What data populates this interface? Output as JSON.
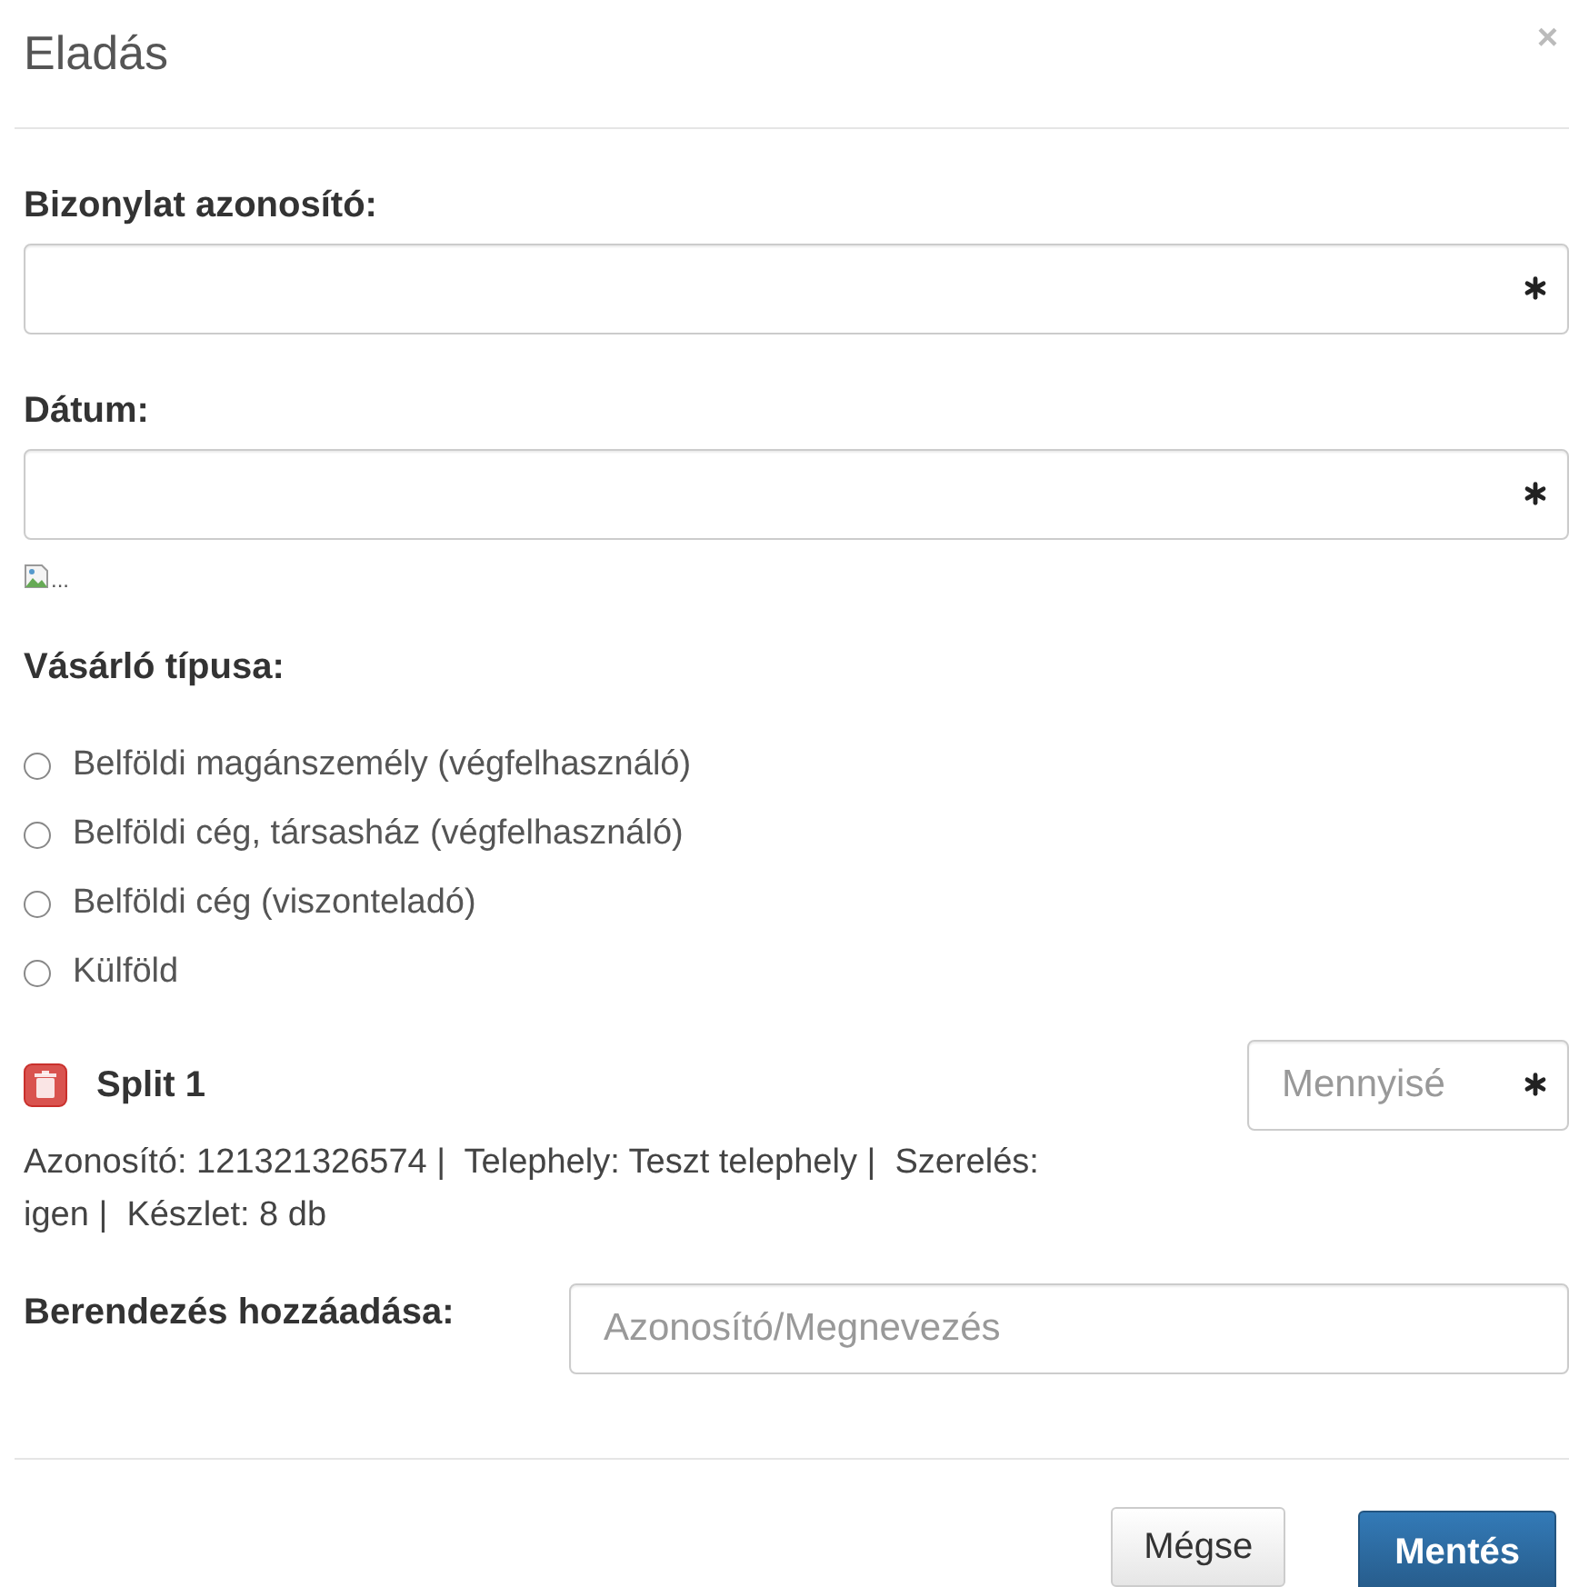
{
  "dialog": {
    "title": "Eladás",
    "close": "×"
  },
  "fields": [
    {
      "label": "Bizonylat azonosító:",
      "required": true
    },
    {
      "label": "Dátum:",
      "required": true
    }
  ],
  "image": {
    "alt": "..."
  },
  "customer_type": {
    "label": "Vásárló típusa:",
    "options": [
      {
        "label": "Belföldi magánszemély (végfelhasználó)",
        "selected": false
      },
      {
        "label": "Belföldi cég, társasház (végfelhasználó)",
        "selected": false
      },
      {
        "label": "Belföldi cég (viszonteladó)",
        "selected": false
      },
      {
        "label": "Külföld",
        "selected": false
      }
    ]
  },
  "item": {
    "name": "Split 1",
    "quantity": {
      "placeholder": "Mennyisé",
      "required": true
    },
    "details": "Azonosító: 121321326574 |  Telephely: Teszt telephely |  Szerelés: igen |  Készlet: 8 db"
  },
  "add_device": {
    "label": "Berendezés hozzáadása:",
    "placeholder": "Azonosító/Megnevezés"
  },
  "buttons": [
    {
      "label": "Mégse",
      "kind": "default"
    },
    {
      "label": "Mentés",
      "kind": "primary"
    }
  ]
}
